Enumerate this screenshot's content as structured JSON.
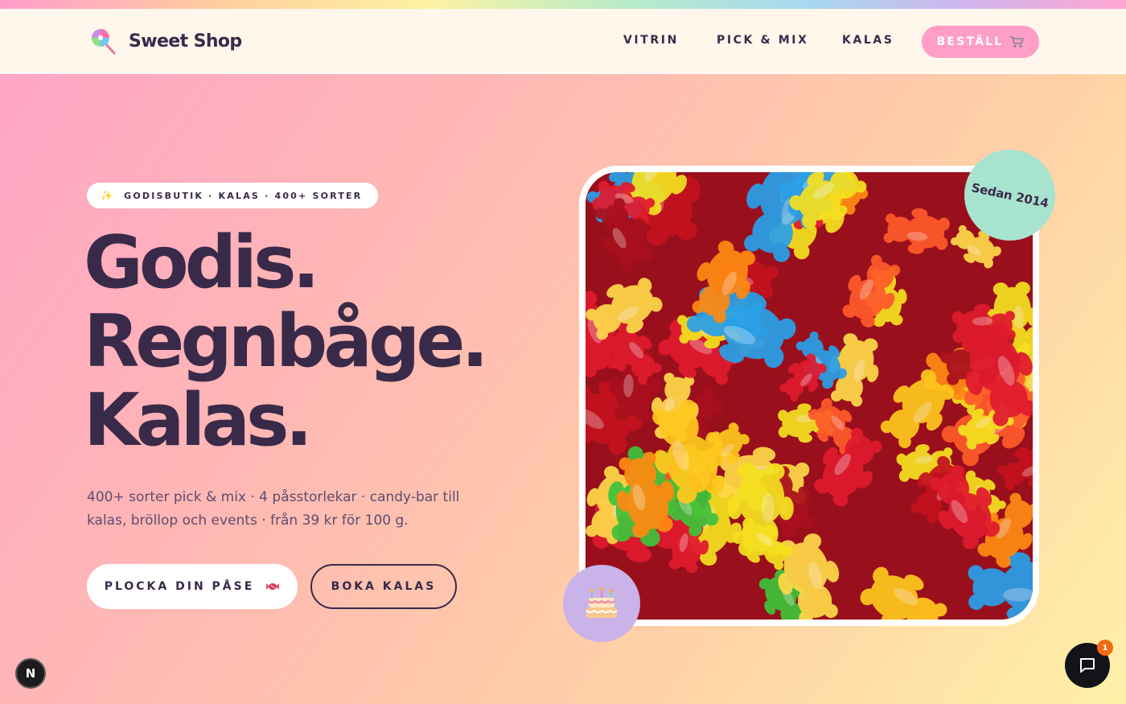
{
  "brand": {
    "name": "Sweet Shop",
    "logo_icon": "lollipop-icon"
  },
  "nav": {
    "links": [
      "VITRIN",
      "PICK & MIX",
      "KALAS"
    ],
    "order_button": "BESTÄLL",
    "order_icon": "cart-icon"
  },
  "hero": {
    "badge_icon": "sparkles-icon",
    "badge_text": "GODISBUTIK · KALAS · 400+ SORTER",
    "headline": [
      "Godis.",
      "Regnbåge.",
      "Kalas."
    ],
    "subtext": "400+ sorter pick & mix · 4 påsstorlekar · candy-bar till kalas, bröllop och events · från 39 kr för 100 g.",
    "primary_button": "PLOCKA DIN PÅSE",
    "primary_button_icon": "candy-icon",
    "secondary_button": "BOKA KALAS",
    "since_badge": "Sedan 2014",
    "cake_icon": "birthday-cake-icon",
    "photo": "gummy-bears-photo"
  },
  "widgets": {
    "n_badge": "N",
    "chat_icon": "chat-icon",
    "chat_count": "1"
  },
  "colors": {
    "dark_text": "#3a2a4a",
    "pink_button": "#ff9ec6",
    "mint_badge": "#a7e3cf",
    "lavender_badge": "#c9b3e8",
    "nav_background": "#fff6ec",
    "notification": "#f26a12"
  }
}
